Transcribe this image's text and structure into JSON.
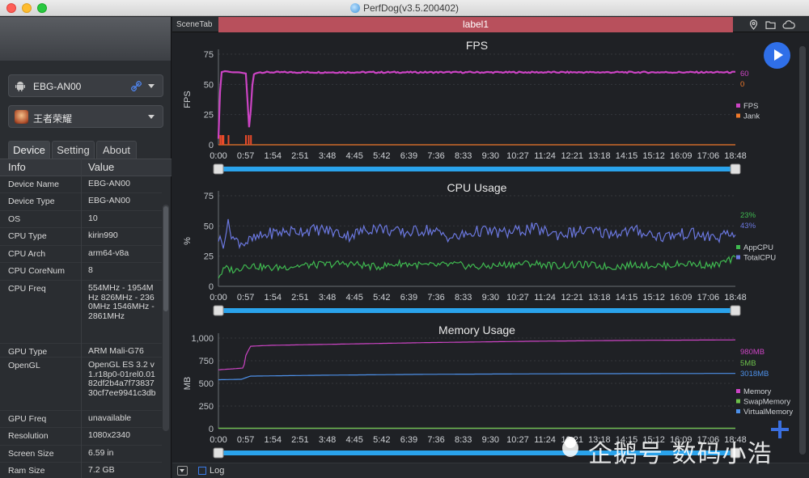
{
  "window": {
    "title": "PerfDog(v3.5.200402)"
  },
  "sidebar": {
    "device_select": "EBG-AN00",
    "app_select": "王者荣耀",
    "tabs": [
      {
        "label": "Device"
      },
      {
        "label": "Setting"
      },
      {
        "label": "About"
      }
    ],
    "table": {
      "headers": {
        "key": "Info",
        "value": "Value"
      },
      "rows": [
        {
          "k": "Device Name",
          "v": "EBG-AN00"
        },
        {
          "k": "Device Type",
          "v": "EBG-AN00"
        },
        {
          "k": "OS",
          "v": "10"
        },
        {
          "k": "CPU Type",
          "v": "kirin990"
        },
        {
          "k": "CPU Arch",
          "v": "arm64-v8a"
        },
        {
          "k": "CPU CoreNum",
          "v": "8"
        },
        {
          "k": "CPU Freq",
          "v": "554MHz - 1954MHz 826MHz - 2360MHz 1546MHz - 2861MHz"
        },
        {
          "k": "GPU Type",
          "v": "ARM Mali-G76"
        },
        {
          "k": "OpenGL",
          "v": "OpenGL ES 3.2 v1.r18p0-01rel0.0182df2b4a7f7383730cf7ee9941c3db"
        },
        {
          "k": "GPU Freq",
          "v": "unavailable"
        },
        {
          "k": "Resolution",
          "v": "1080x2340"
        },
        {
          "k": "Screen Size",
          "v": "6.59 in"
        },
        {
          "k": "Ram Size",
          "v": "7.2 GB"
        }
      ]
    }
  },
  "main": {
    "scene_tab_label": "SceneTab",
    "label_bar": "label1",
    "bottom": {
      "log_label": "Log"
    }
  },
  "watermark": {
    "text": "企鹅号 数码小浩"
  },
  "chart_data": [
    {
      "type": "line",
      "title": "FPS",
      "ylabel": "FPS",
      "ylim": [
        0,
        75
      ],
      "yticks": [
        0,
        25,
        50,
        75
      ],
      "xticks": [
        "0:00",
        "0:57",
        "1:54",
        "2:51",
        "3:48",
        "4:45",
        "5:42",
        "6:39",
        "7:36",
        "8:33",
        "9:30",
        "10:27",
        "11:24",
        "12:21",
        "13:18",
        "14:15",
        "15:12",
        "16:09",
        "17:06",
        "18:48"
      ],
      "xlim_seconds": [
        0,
        1128
      ],
      "series": [
        {
          "name": "FPS",
          "color": "#cc44c4",
          "current": "60",
          "points": [
            [
              0,
              5
            ],
            [
              5,
              60
            ],
            [
              15,
              61
            ],
            [
              30,
              60
            ],
            [
              45,
              60
            ],
            [
              60,
              59
            ],
            [
              68,
              8
            ],
            [
              72,
              40
            ],
            [
              76,
              58
            ],
            [
              85,
              60
            ],
            [
              120,
              60
            ],
            [
              600,
              60
            ],
            [
              1128,
              60
            ]
          ]
        },
        {
          "name": "Jank",
          "color": "#f07a2a",
          "current": "0",
          "points": [
            [
              0,
              0
            ],
            [
              60,
              0
            ],
            [
              68,
              0
            ],
            [
              72,
              0
            ],
            [
              1128,
              0
            ]
          ]
        }
      ],
      "legend": "right"
    },
    {
      "type": "line",
      "title": "CPU Usage",
      "ylabel": "%",
      "ylim": [
        0,
        75
      ],
      "yticks": [
        0,
        25,
        50,
        75
      ],
      "xticks": [
        "0:00",
        "0:57",
        "1:54",
        "2:51",
        "3:48",
        "4:45",
        "5:42",
        "6:39",
        "7:36",
        "8:33",
        "9:30",
        "10:27",
        "11:24",
        "12:21",
        "13:18",
        "14:15",
        "15:12",
        "16:09",
        "17:06",
        "18:48"
      ],
      "xlim_seconds": [
        0,
        1128
      ],
      "series": [
        {
          "name": "AppCPU",
          "color": "#3fb950",
          "current": "23%",
          "points": [
            [
              0,
              8
            ],
            [
              15,
              15
            ],
            [
              40,
              13
            ],
            [
              57,
              18
            ],
            [
              114,
              15
            ],
            [
              171,
              17
            ],
            [
              228,
              18
            ],
            [
              285,
              19
            ],
            [
              342,
              16
            ],
            [
              399,
              19
            ],
            [
              456,
              17
            ],
            [
              513,
              18
            ],
            [
              570,
              16
            ],
            [
              627,
              18
            ],
            [
              684,
              19
            ],
            [
              741,
              17
            ],
            [
              798,
              18
            ],
            [
              855,
              16
            ],
            [
              912,
              18
            ],
            [
              969,
              17
            ],
            [
              1026,
              19
            ],
            [
              1080,
              17
            ],
            [
              1128,
              23
            ]
          ]
        },
        {
          "name": "TotalCPU",
          "color": "#6b78e0",
          "current": "43%",
          "points": [
            [
              0,
              40
            ],
            [
              10,
              35
            ],
            [
              20,
              52
            ],
            [
              35,
              38
            ],
            [
              57,
              36
            ],
            [
              114,
              44
            ],
            [
              171,
              46
            ],
            [
              228,
              47
            ],
            [
              285,
              42
            ],
            [
              342,
              49
            ],
            [
              399,
              44
            ],
            [
              456,
              47
            ],
            [
              513,
              40
            ],
            [
              570,
              46
            ],
            [
              627,
              44
            ],
            [
              684,
              48
            ],
            [
              741,
              43
            ],
            [
              798,
              46
            ],
            [
              855,
              44
            ],
            [
              912,
              46
            ],
            [
              969,
              41
            ],
            [
              1026,
              44
            ],
            [
              1080,
              40
            ],
            [
              1128,
              43
            ]
          ]
        }
      ],
      "legend": "right"
    },
    {
      "type": "line",
      "title": "Memory Usage",
      "ylabel": "MB",
      "ylim": [
        0,
        1000
      ],
      "yticks": [
        0,
        250,
        500,
        750,
        1000
      ],
      "xticks": [
        "0:00",
        "0:57",
        "1:54",
        "2:51",
        "3:48",
        "4:45",
        "5:42",
        "6:39",
        "7:36",
        "8:33",
        "9:30",
        "10:27",
        "11:24",
        "12:21",
        "13:18",
        "14:15",
        "15:12",
        "16:09",
        "17:06",
        "18:48"
      ],
      "xlim_seconds": [
        0,
        1128
      ],
      "series": [
        {
          "name": "Memory",
          "color": "#cc44c4",
          "current": "980MB",
          "points": [
            [
              0,
              650
            ],
            [
              30,
              660
            ],
            [
              55,
              670
            ],
            [
              60,
              810
            ],
            [
              70,
              910
            ],
            [
              114,
              920
            ],
            [
              228,
              930
            ],
            [
              456,
              950
            ],
            [
              684,
              965
            ],
            [
              912,
              975
            ],
            [
              1128,
              980
            ]
          ]
        },
        {
          "name": "SwapMemory",
          "color": "#6cc04a",
          "current": "5MB",
          "points": [
            [
              0,
              5
            ],
            [
              1128,
              5
            ]
          ]
        },
        {
          "name": "VirtualMemory",
          "color": "#4d90e8",
          "current": "3018MB",
          "points": [
            [
              0,
              540
            ],
            [
              50,
              545
            ],
            [
              70,
              580
            ],
            [
              228,
              590
            ],
            [
              456,
              600
            ],
            [
              684,
              605
            ],
            [
              912,
              608
            ],
            [
              1128,
              610
            ]
          ]
        }
      ],
      "legend": "right"
    }
  ]
}
